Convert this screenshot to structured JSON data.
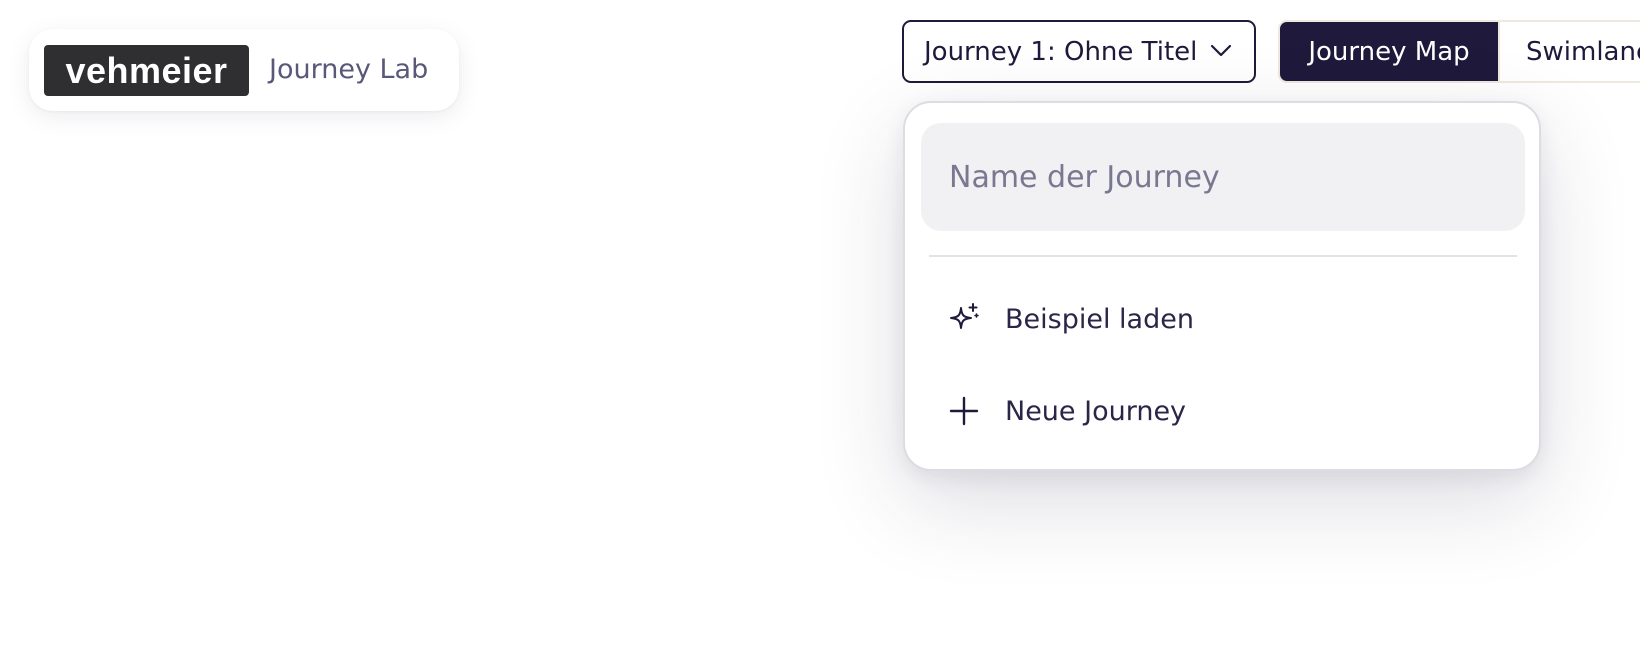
{
  "brand": {
    "logo_text": "vehmeier",
    "app_name": "Journey Lab"
  },
  "journey_selector": {
    "label": "Journey 1: Ohne Titel",
    "icon": "chevron-down-icon"
  },
  "view_toggle": {
    "options": [
      {
        "label": "Journey Map",
        "active": true
      },
      {
        "label": "Swimlane",
        "active": false
      }
    ]
  },
  "dropdown": {
    "name_input": {
      "placeholder": "Name der Journey",
      "value": ""
    },
    "items": [
      {
        "label": "Beispiel laden",
        "icon": "sparkle-icon"
      },
      {
        "label": "Neue Journey",
        "icon": "plus-icon"
      }
    ]
  },
  "colors": {
    "primary": "#1f1a3b",
    "logo_bg": "#2f2f31",
    "input_bg": "#f1f1f4",
    "toggle_border": "#efe8de"
  }
}
